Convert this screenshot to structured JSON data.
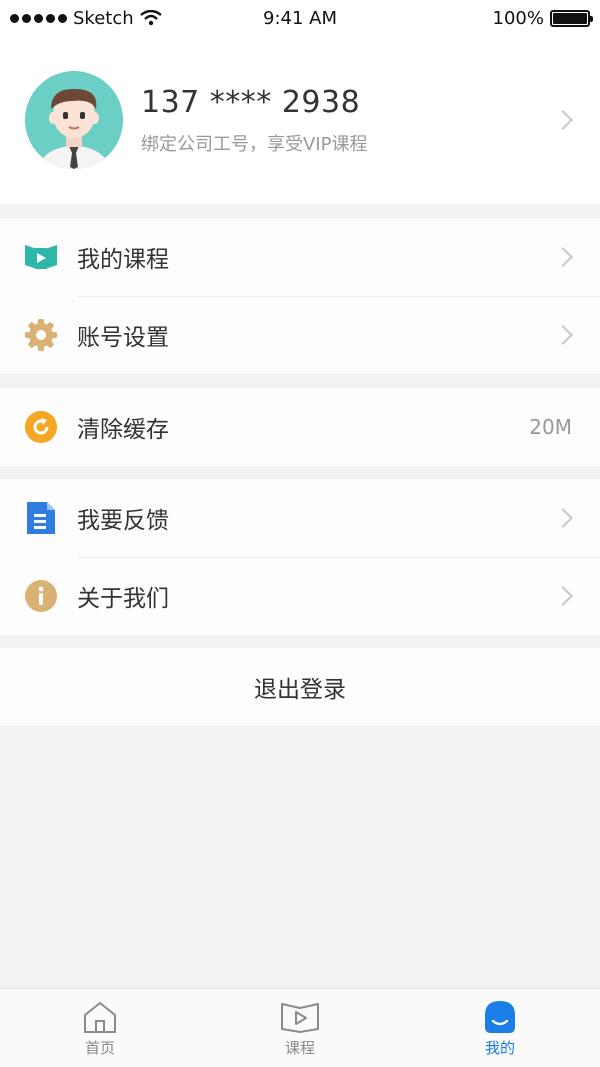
{
  "status_bar": {
    "carrier": "Sketch",
    "time": "9:41 AM",
    "battery": "100%"
  },
  "profile": {
    "phone": "137 **** 2938",
    "hint": "绑定公司工号，享受VIP课程"
  },
  "menu": {
    "my_courses": "我的课程",
    "account_settings": "账号设置",
    "clear_cache": "清除缓存",
    "cache_size": "20M",
    "feedback": "我要反馈",
    "about": "关于我们"
  },
  "logout_label": "退出登录",
  "tabs": [
    {
      "label": "首页",
      "icon": "home-icon"
    },
    {
      "label": "课程",
      "icon": "video-icon"
    },
    {
      "label": "我的",
      "icon": "profile-icon"
    }
  ],
  "colors": {
    "accent": "#1a7ee6",
    "teal": "#2cb7a8",
    "gold": "#d9b174",
    "orange": "#f5a623",
    "blue": "#2f7de1"
  }
}
